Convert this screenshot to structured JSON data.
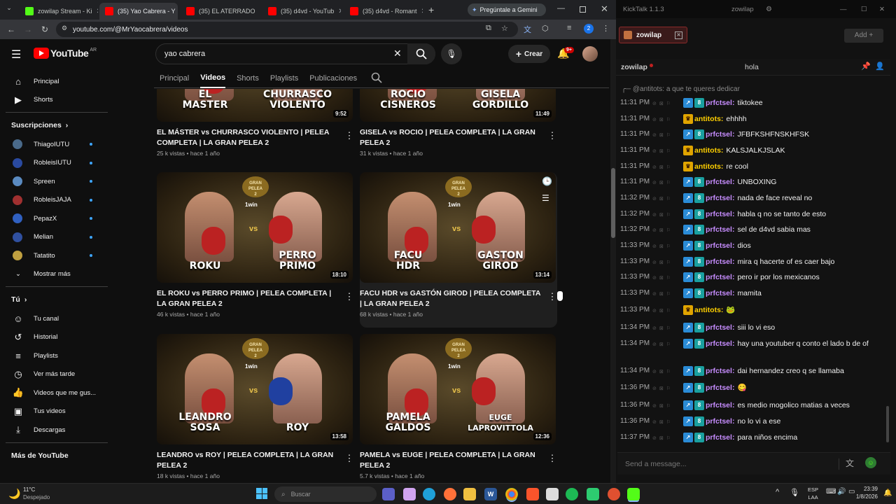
{
  "browser": {
    "tabs": [
      {
        "label": "zowilap Stream - Ki",
        "active": false,
        "color": "#53fc18"
      },
      {
        "label": "(35) Yao Cabrera - Y",
        "active": true,
        "color": "#ff0000"
      },
      {
        "label": "(35) EL ATERRADO",
        "active": false,
        "color": "#ff0000"
      },
      {
        "label": "(35) d4vd - YouTub",
        "active": false,
        "color": "#ff0000"
      },
      {
        "label": "(35) d4vd - Romant",
        "active": false,
        "color": "#ff0000"
      }
    ],
    "gemini_label": "Pregúntale a Gemini",
    "url": "youtube.com/@MrYaocabrera/videos",
    "profile_badge": "2"
  },
  "youtube": {
    "logo": "YouTube",
    "region": "AR",
    "search_value": "yao cabrera",
    "create_label": "Crear",
    "notif_badge": "9+",
    "nav": [
      {
        "label": "Principal",
        "icon": "home-icon"
      },
      {
        "label": "Shorts",
        "icon": "shorts-icon"
      }
    ],
    "subs_header": "Suscripciones",
    "subs": [
      {
        "label": "ThiagoIUTU",
        "color": "#4a6a8a"
      },
      {
        "label": "RobleisIUTU",
        "color": "#2a4aa0"
      },
      {
        "label": "Spreen",
        "color": "#5a8ac0"
      },
      {
        "label": "RobleisJAJA",
        "color": "#a03030"
      },
      {
        "label": "PepazX",
        "color": "#3060c0"
      },
      {
        "label": "Melian",
        "color": "#3050a0"
      },
      {
        "label": "Tatatito",
        "color": "#c0a040"
      }
    ],
    "show_more": "Mostrar más",
    "you_header": "Tú",
    "you_items": [
      {
        "label": "Tu canal",
        "icon": "user-icon"
      },
      {
        "label": "Historial",
        "icon": "history-icon"
      },
      {
        "label": "Playlists",
        "icon": "playlist-icon"
      },
      {
        "label": "Ver más tarde",
        "icon": "clock-icon"
      },
      {
        "label": "Videos que me gus...",
        "icon": "like-icon"
      },
      {
        "label": "Tus videos",
        "icon": "video-icon"
      },
      {
        "label": "Descargas",
        "icon": "download-icon"
      }
    ],
    "more_header": "Más de YouTube",
    "channel_tabs": [
      "Principal",
      "Videos",
      "Shorts",
      "Playlists",
      "Publicaciones"
    ],
    "active_tab": "Videos",
    "videos": [
      {
        "left": "EL\nMASTER",
        "right": "CHURRASCO\nVIOLENTO",
        "duration": "9:52",
        "title": "EL MÁSTER vs CHURRASCO VIOLENTO | PELEA COMPLETA | LA GRAN PELEA 2",
        "meta": "25 k vistas • hace 1 año"
      },
      {
        "left": "ROCIO\nCISNEROS",
        "right": "GISELA\nGORDILLO",
        "duration": "11:49",
        "title": "GISELA vs ROCIO | PELEA COMPLETA | LA GRAN PELEA 2",
        "meta": "31 k vistas • hace 1 año"
      },
      {
        "left": "ROKU",
        "right": "PERRO\nPRIMO",
        "duration": "18:10",
        "title": "EL ROKU vs PERRO PRIMO | PELEA COMPLETA | LA GRAN PELEA 2",
        "meta": "46 k vistas • hace 1 año"
      },
      {
        "left": "FACU\nHDR",
        "right": "GASTON\nGIROD",
        "duration": "13:14",
        "title": "FACU HDR vs GASTÓN GIROD | PELEA COMPLETA | LA GRAN PELEA 2",
        "meta": "68 k vistas • hace 1 año"
      },
      {
        "left": "LEANDRO\nSOSA",
        "right": "ROY",
        "duration": "13:58",
        "title": "LEANDRO vs ROY | PELEA COMPLETA | LA GRAN PELEA 2",
        "meta": "18 k vistas • hace 1 año"
      },
      {
        "left": "PAMELA\nGALDOS",
        "right": "EUGE\nLAPROVITTOLA",
        "duration": "12:36",
        "title": "PAMELA vs EUGE | PELEA COMPLETA | LA GRAN PELEA 2",
        "meta": "5.7 k vistas • hace 1 año"
      }
    ],
    "thumb_logo": "GRAN\nPELEA\n2",
    "thumb_win": "1win",
    "thumb_vs": "vs"
  },
  "kicktalk": {
    "app_title": "KickTalk 1.1.3",
    "window_user": "zowilap",
    "tab_label": "zowilap",
    "add_label": "Add +",
    "channel": "zowilap",
    "chat_title": "hola",
    "reply_preview": "@antitots: a que te queres dedicar",
    "input_placeholder": "Send a message...",
    "messages": [
      {
        "time": "11:31 PM",
        "user": "prfctsel",
        "text": "tiktokee",
        "color": "#c78dff",
        "badges": [
          "b",
          "g"
        ]
      },
      {
        "time": "11:31 PM",
        "user": "antitots",
        "text": "ehhhh",
        "color": "#ffd000",
        "badges": [
          "c"
        ]
      },
      {
        "time": "11:31 PM",
        "user": "prfctsel",
        "text": "JFBFKSHFNSKHFSK",
        "color": "#c78dff",
        "badges": [
          "b",
          "g"
        ]
      },
      {
        "time": "11:31 PM",
        "user": "antitots",
        "text": "KALSJALKJSLAK",
        "color": "#ffd000",
        "badges": [
          "c"
        ]
      },
      {
        "time": "11:31 PM",
        "user": "antitots",
        "text": "re cool",
        "color": "#ffd000",
        "badges": [
          "c"
        ]
      },
      {
        "time": "11:31 PM",
        "user": "prfctsel",
        "text": "UNBOXING",
        "color": "#c78dff",
        "badges": [
          "b",
          "g"
        ]
      },
      {
        "time": "11:32 PM",
        "user": "prfctsel",
        "text": "nada de face reveal no",
        "color": "#c78dff",
        "badges": [
          "b",
          "g"
        ]
      },
      {
        "time": "11:32 PM",
        "user": "prfctsel",
        "text": "habla q no se tanto de esto",
        "color": "#c78dff",
        "badges": [
          "b",
          "g"
        ]
      },
      {
        "time": "11:32 PM",
        "user": "prfctsel",
        "text": "sel de d4vd sabia mas",
        "color": "#c78dff",
        "badges": [
          "b",
          "g"
        ]
      },
      {
        "time": "11:33 PM",
        "user": "prfctsel",
        "text": "dios",
        "color": "#c78dff",
        "badges": [
          "b",
          "g"
        ]
      },
      {
        "time": "11:33 PM",
        "user": "prfctsel",
        "text": "mira q hacerte of es caer bajo",
        "color": "#c78dff",
        "badges": [
          "b",
          "g"
        ]
      },
      {
        "time": "11:33 PM",
        "user": "prfctsel",
        "text": "pero ir por los mexicanos",
        "color": "#c78dff",
        "badges": [
          "b",
          "g"
        ]
      },
      {
        "time": "11:33 PM",
        "user": "prfctsel",
        "text": "mamita",
        "color": "#c78dff",
        "badges": [
          "b",
          "g"
        ]
      },
      {
        "time": "11:33 PM",
        "user": "antitots",
        "text": "🐸",
        "color": "#ffd000",
        "badges": [
          "c"
        ]
      },
      {
        "time": "11:34 PM",
        "user": "prfctsel",
        "text": "siii lo vi eso",
        "color": "#c78dff",
        "badges": [
          "b",
          "g"
        ]
      },
      {
        "time": "11:34 PM",
        "user": "prfctsel",
        "text": "hay una youtuber q conto el lado b de of",
        "color": "#c78dff",
        "badges": [
          "b",
          "g"
        ]
      },
      {
        "time": "11:34 PM",
        "user": "prfctsel",
        "text": "dai hernandez creo q se llamaba",
        "color": "#c78dff",
        "badges": [
          "b",
          "g"
        ]
      },
      {
        "time": "11:36 PM",
        "user": "prfctsel",
        "text": "😋",
        "color": "#c78dff",
        "badges": [
          "b",
          "g"
        ]
      },
      {
        "time": "11:36 PM",
        "user": "prfctsel",
        "text": "es medio mogolico matias a veces",
        "color": "#c78dff",
        "badges": [
          "b",
          "g"
        ]
      },
      {
        "time": "11:36 PM",
        "user": "prfctsel",
        "text": "no lo vi a ese",
        "color": "#c78dff",
        "badges": [
          "b",
          "g"
        ]
      },
      {
        "time": "11:37 PM",
        "user": "prfctsel",
        "text": "para niños encima",
        "color": "#c78dff",
        "badges": [
          "b",
          "g"
        ]
      }
    ]
  },
  "taskbar": {
    "weather_temp": "11°C",
    "weather_desc": "Despejado",
    "search_placeholder": "Buscar",
    "lang1": "ESP",
    "lang2": "LAA",
    "time": "23:39",
    "date": "1/8/2026"
  }
}
